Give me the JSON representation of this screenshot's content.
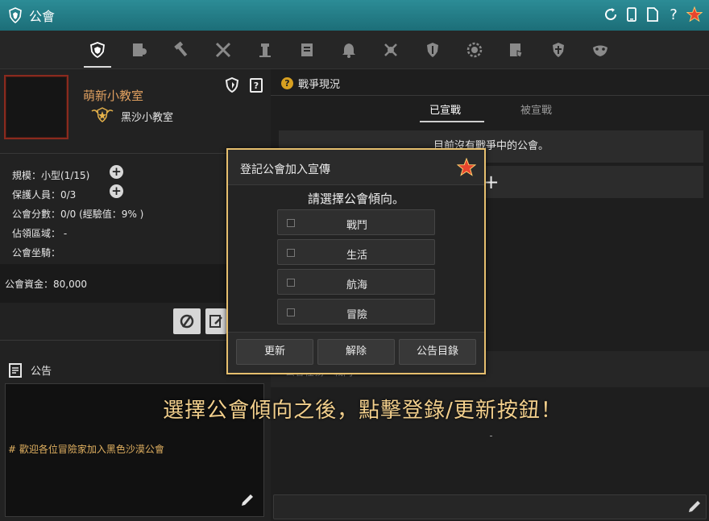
{
  "window": {
    "title": "公會",
    "title_icon": "guild-crest-icon",
    "controls": [
      "refresh-icon",
      "mobile-icon",
      "page-icon",
      "help-icon",
      "close-star-icon"
    ],
    "help_label": "?"
  },
  "iconbar": {
    "tabs": [
      "guild-crest-icon",
      "member-icon",
      "hammer-icon",
      "swords-icon",
      "tower-icon",
      "scroll-icon",
      "bell-icon",
      "axes-icon",
      "shield-icon",
      "laurel-icon",
      "contract-icon",
      "cross-shield-icon",
      "mask-icon"
    ],
    "active_index": 0
  },
  "guild": {
    "name": "萌新小教室",
    "leader": "黑沙小教室",
    "stats": {
      "scale": "規模：小型(1/15)",
      "guards": "保護人員：0/3",
      "points": "公會分數：0/0 (經驗值：9% )",
      "territory": "佔領區域： -",
      "mount": "公會坐騎："
    },
    "funds": "公會資金：80,000"
  },
  "notice": {
    "title": "公告",
    "text": "# 歡迎各位冒險家加入黑色沙漠公會"
  },
  "war": {
    "title": "戰爭現況",
    "help_label": "?",
    "tabs": [
      "已宣戰",
      "被宣戰"
    ],
    "message": "目前沒有戰爭中的公會。",
    "add_label": "+",
    "lower_text": "公會任務 - 戰鬥",
    "dash": "-"
  },
  "modal": {
    "title": "登記公會加入宣傳",
    "prompt": "請選擇公會傾向。",
    "options": [
      "戰鬥",
      "生活",
      "航海",
      "冒險"
    ],
    "buttons": [
      "更新",
      "解除",
      "公告目錄"
    ]
  },
  "caption": "選擇公會傾向之後，點擊登錄/更新按鈕！",
  "colors": {
    "accent_teal": "#1c6e78",
    "modal_border": "#e6bf6e",
    "guild_name": "#e0a060",
    "caption": "#f2cf8c"
  }
}
